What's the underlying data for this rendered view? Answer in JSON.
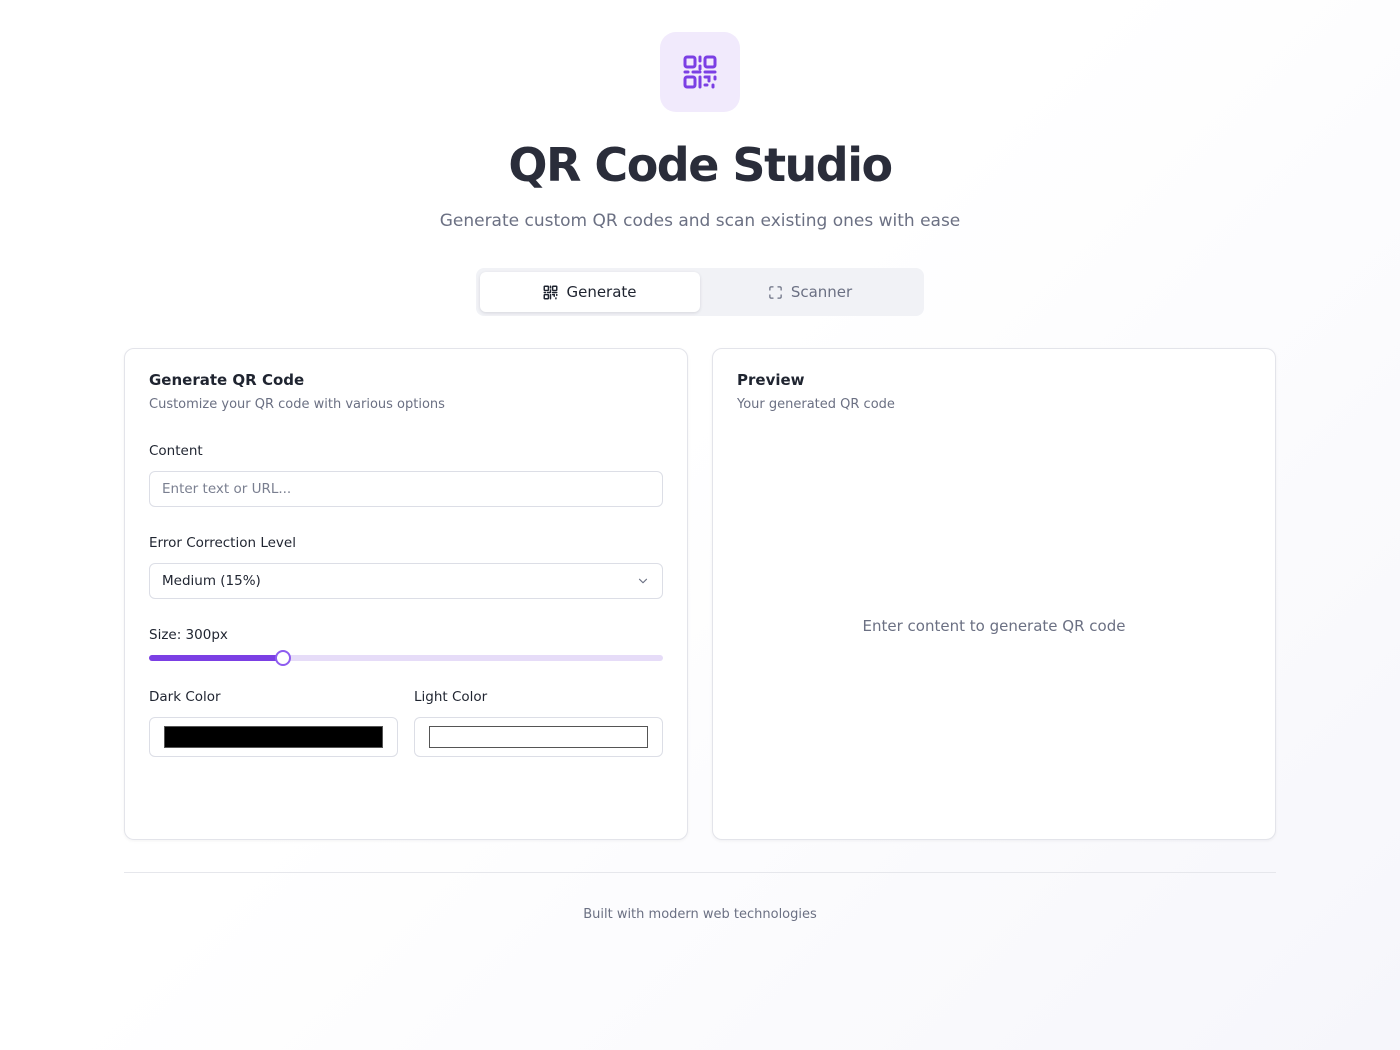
{
  "header": {
    "logo_icon": "qr-code-icon",
    "title": "QR Code Studio",
    "subtitle": "Generate custom QR codes and scan existing ones with ease"
  },
  "tabs": [
    {
      "label": "Generate",
      "icon": "qr-code-icon",
      "active": true
    },
    {
      "label": "Scanner",
      "icon": "scan-frame-icon",
      "active": false
    }
  ],
  "generator": {
    "title": "Generate QR Code",
    "description": "Customize your QR code with various options",
    "content_label": "Content",
    "content_value": "",
    "content_placeholder": "Enter text or URL...",
    "error_label": "Error Correction Level",
    "error_value": "Medium (15%)",
    "size_label": "Size: 300px",
    "size_fraction": 0.26,
    "dark_label": "Dark Color",
    "dark_color": "#000000",
    "light_label": "Light Color",
    "light_color": "#ffffff"
  },
  "preview": {
    "title": "Preview",
    "description": "Your generated QR code",
    "empty_message": "Enter content to generate QR code"
  },
  "footer": {
    "text": "Built with modern web technologies"
  },
  "colors": {
    "accent": "#7b3fe4",
    "accent_light": "#f1eafc"
  }
}
